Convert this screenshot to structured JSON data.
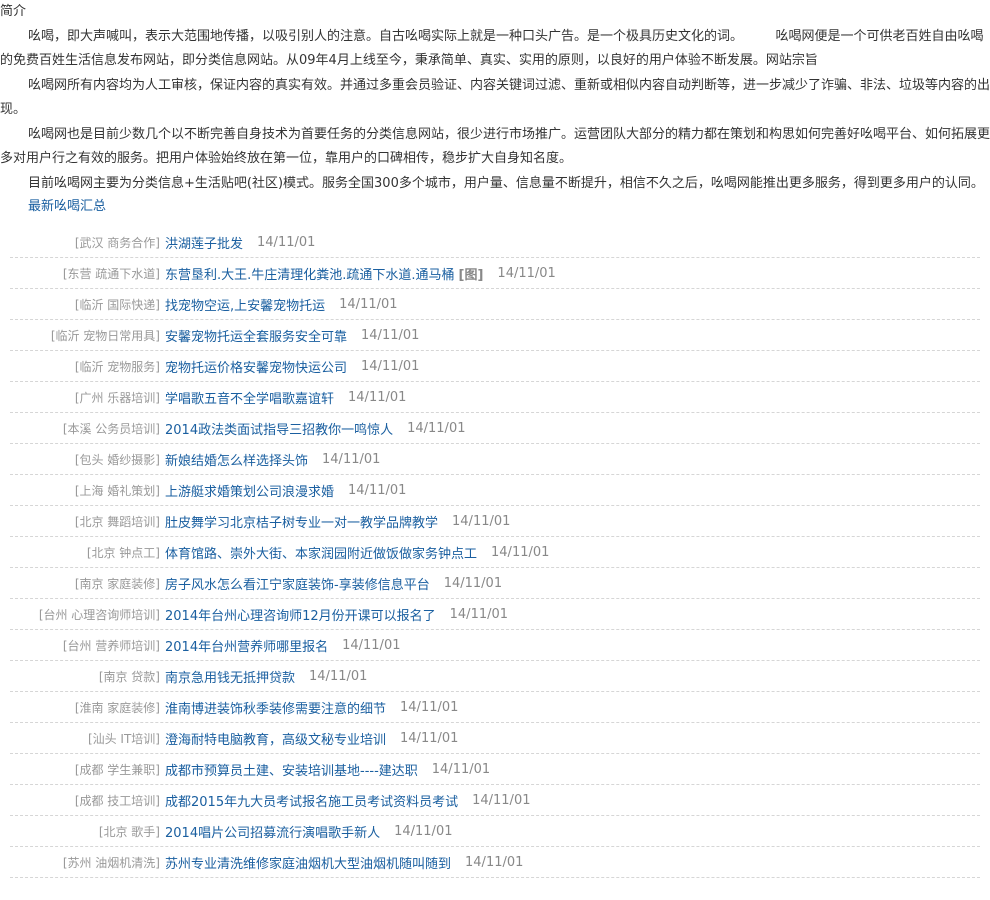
{
  "intro": {
    "title": "简介",
    "paragraphs": [
      "吆喝，即大声喊叫，表示大范围地传播，以吸引别人的注意。自古吆喝实际上就是一种口头广告。是一个极具历史文化的词。　　　吆喝网便是一个可供老百姓自由吆喝的免费百姓生活信息发布网站，即分类信息网站。从09年4月上线至今，秉承简单、真实、实用的原则，以良好的用户体验不断发展。网站宗旨",
      "吆喝网所有内容均为人工审核，保证内容的真实有效。并通过多重会员验证、内容关键词过滤、重新或相似内容自动判断等，进一步减少了诈骗、非法、垃圾等内容的出现。",
      "吆喝网也是目前少数几个以不断完善自身技术为首要任务的分类信息网站，很少进行市场推广。运营团队大部分的精力都在策划和构思如何完善好吆喝平台、如何拓展更多对用户行之有效的服务。把用户体验始终放在第一位，靠用户的口碑相传，稳步扩大自身知名度。",
      "目前吆喝网主要为分类信息+生活贴吧(社区)模式。服务全国300多个城市，用户量、信息量不断提升，相信不久之后，吆喝网能推出更多服务，得到更多用户的认同。"
    ]
  },
  "latest_label": "最新吆喝汇总",
  "items": [
    {
      "cat": "[武汉 商务合作]",
      "title": "洪湖莲子批发",
      "img": "",
      "date": "14/11/01"
    },
    {
      "cat": "[东营 疏通下水道]",
      "title": "东营垦利.大王.牛庄清理化粪池.疏通下水道.通马桶",
      "img": "[图]",
      "date": "14/11/01"
    },
    {
      "cat": "[临沂 国际快递]",
      "title": "找宠物空运,上安馨宠物托运",
      "img": "",
      "date": "14/11/01"
    },
    {
      "cat": "[临沂 宠物日常用具]",
      "title": "安馨宠物托运全套服务安全可靠",
      "img": "",
      "date": "14/11/01"
    },
    {
      "cat": "[临沂 宠物服务]",
      "title": "宠物托运价格安馨宠物快运公司",
      "img": "",
      "date": "14/11/01"
    },
    {
      "cat": "[广州 乐器培训]",
      "title": "学唱歌五音不全学唱歌嘉谊轩",
      "img": "",
      "date": "14/11/01"
    },
    {
      "cat": "[本溪 公务员培训]",
      "title": "2014政法类面试指导三招教你一鸣惊人",
      "img": "",
      "date": "14/11/01"
    },
    {
      "cat": "[包头 婚纱摄影]",
      "title": "新娘结婚怎么样选择头饰",
      "img": "",
      "date": "14/11/01"
    },
    {
      "cat": "[上海 婚礼策划]",
      "title": "上游艇求婚策划公司浪漫求婚",
      "img": "",
      "date": "14/11/01"
    },
    {
      "cat": "[北京 舞蹈培训]",
      "title": "肚皮舞学习北京桔子树专业一对一教学品牌教学",
      "img": "",
      "date": "14/11/01"
    },
    {
      "cat": "[北京 钟点工]",
      "title": "体育馆路、崇外大街、本家润园附近做饭做家务钟点工",
      "img": "",
      "date": "14/11/01"
    },
    {
      "cat": "[南京 家庭装修]",
      "title": "房子风水怎么看江宁家庭装饰-享装修信息平台",
      "img": "",
      "date": "14/11/01"
    },
    {
      "cat": "[台州 心理咨询师培训]",
      "title": "2014年台州心理咨询师12月份开课可以报名了",
      "img": "",
      "date": "14/11/01"
    },
    {
      "cat": "[台州 营养师培训]",
      "title": "2014年台州营养师哪里报名",
      "img": "",
      "date": "14/11/01"
    },
    {
      "cat": "[南京 贷款]",
      "title": "南京急用钱无抵押贷款",
      "img": "",
      "date": "14/11/01"
    },
    {
      "cat": "[淮南 家庭装修]",
      "title": "淮南博进装饰秋季装修需要注意的细节",
      "img": "",
      "date": "14/11/01"
    },
    {
      "cat": "[汕头 IT培训]",
      "title": "澄海耐特电脑教育，高级文秘专业培训",
      "img": "",
      "date": "14/11/01"
    },
    {
      "cat": "[成都 学生兼职]",
      "title": "成都市预算员土建、安装培训基地----建达职",
      "img": "",
      "date": "14/11/01"
    },
    {
      "cat": "[成都 技工培训]",
      "title": "成都2015年九大员考试报名施工员考试资料员考试",
      "img": "",
      "date": "14/11/01"
    },
    {
      "cat": "[北京 歌手]",
      "title": "2014唱片公司招募流行演唱歌手新人",
      "img": "",
      "date": "14/11/01"
    },
    {
      "cat": "[苏州 油烟机清洗]",
      "title": "苏州专业清洗维修家庭油烟机大型油烟机随叫随到",
      "img": "",
      "date": "14/11/01"
    }
  ]
}
